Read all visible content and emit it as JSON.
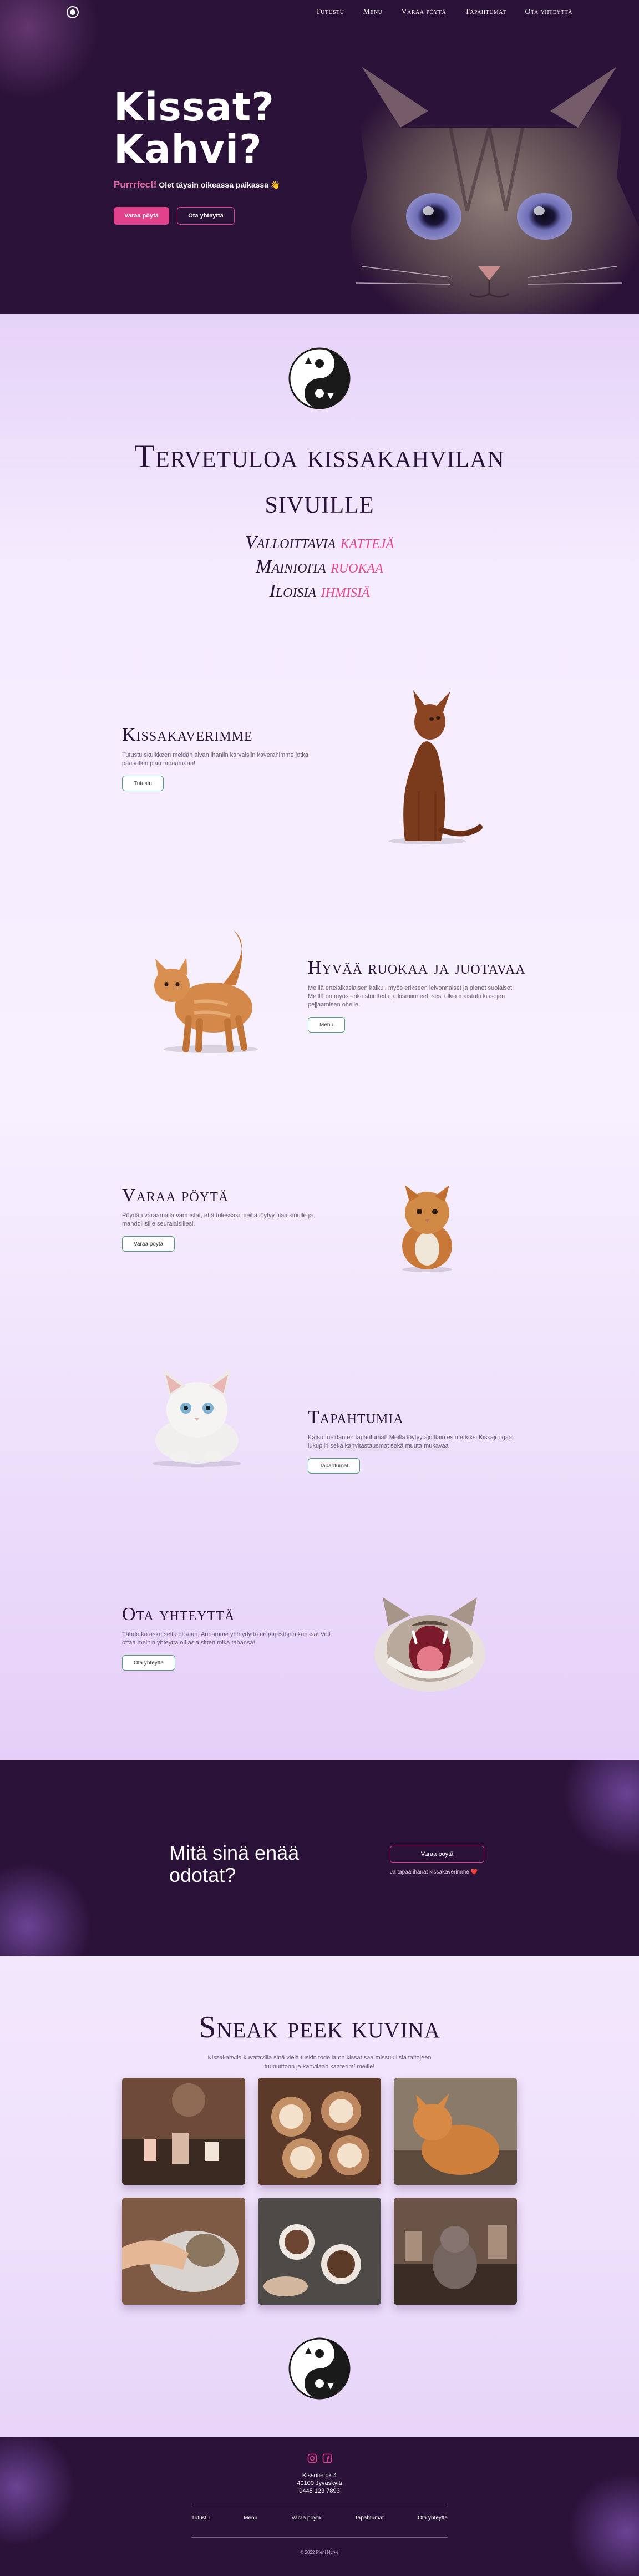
{
  "nav": {
    "links": [
      "Tutustu",
      "Menu",
      "Varaa pöytä",
      "Tapahtumat",
      "Ota yhteyttä"
    ]
  },
  "hero": {
    "title_line1": "Kissat?",
    "title_line2": "Kahvi?",
    "subtitle_highlight": "Purrrfect!",
    "subtitle_rest": "Olet täysin oikeassa paikassa 👋",
    "button_primary": "Varaa pöytä",
    "button_secondary": "Ota yhteyttä"
  },
  "welcome": {
    "title_line1": "Tervetuloa kissakahvilan",
    "title_line2": "sivuille",
    "tagline": [
      {
        "text": "Valloittavia ",
        "highlight": "kattejä"
      },
      {
        "text": "Mainioita ",
        "highlight": "ruokaa"
      },
      {
        "text": "Iloisia ",
        "highlight": "ihmisiä"
      }
    ]
  },
  "features": [
    {
      "title": "Kissakaverimme",
      "text": "Tutustu skuikkeen meidän aivan ihaniin karvaisiin kaverahimme jotka pääsetkin pian tapaamaan!",
      "button": "Tutustu"
    },
    {
      "title": "Hyvää ruokaa ja juotavaa",
      "text": "Meillä ertelaikaslaisen kaikui, myös erikseen leivonnaiset ja pienet suolaiset! Meillä on myös erikoistuotteita ja kismiinneet, sesi ulkia maistutti kissojen pejjaamisen ohelle.",
      "button": "Menu"
    },
    {
      "title": "Varaa pöytä",
      "text": "Pöydän varaamalla varmistat, että tulessasi meillä löytyy tilaa sinulle ja mahdollisille seuralaisillesi.",
      "button": "Varaa pöytä"
    },
    {
      "title": "Tapahtumia",
      "text": "Katso meidän eri tapahtumat! Meillä löytyy ajoittain esimerkiksi Kissajoogaa, lukupiiri sekä kahvitastausmat sekä muuta mukavaa",
      "button": "Tapahtumat"
    },
    {
      "title": "Ota yhteyttä",
      "text": "Tähdotko asketselta olisaan, Annamme yhteydyttä en järjestöjen kanssa! Voit ottaa meihin yhteyttä oli asia sitten mikä tahansa!",
      "button": "Ota yhteyttä"
    }
  ],
  "cta": {
    "title_line1": "Mitä sinä enää",
    "title_line2": "odotat?",
    "button": "Varaa pöytä",
    "note": "Ja tapaa ihanat kissakaverimme ❤️"
  },
  "gallery": {
    "title": "Sneak peek kuvina",
    "description_line1": "Kissakahvila kuvatavilla sinä vielä tuskin todella on kissat saa missuullisia taitojeen",
    "description_line2": "tuunuittoon ja kahvilaan kaaterim! meille!"
  },
  "footer": {
    "address_line1": "Kissotie pk 4",
    "address_line2": "40100 Jyväskylä",
    "address_line3": "0445 123 7893",
    "links": [
      "Tutustu",
      "Menu",
      "Varaa pöytä",
      "Tapahtumat",
      "Ota yhteyttä"
    ],
    "copyright": "© 2022 Pieni Nyrke"
  },
  "colors": {
    "dark_purple": "#2b1238",
    "pink_accent": "#e2418c",
    "green_outline": "#4aa27a",
    "lavender": "#efe4fb"
  }
}
